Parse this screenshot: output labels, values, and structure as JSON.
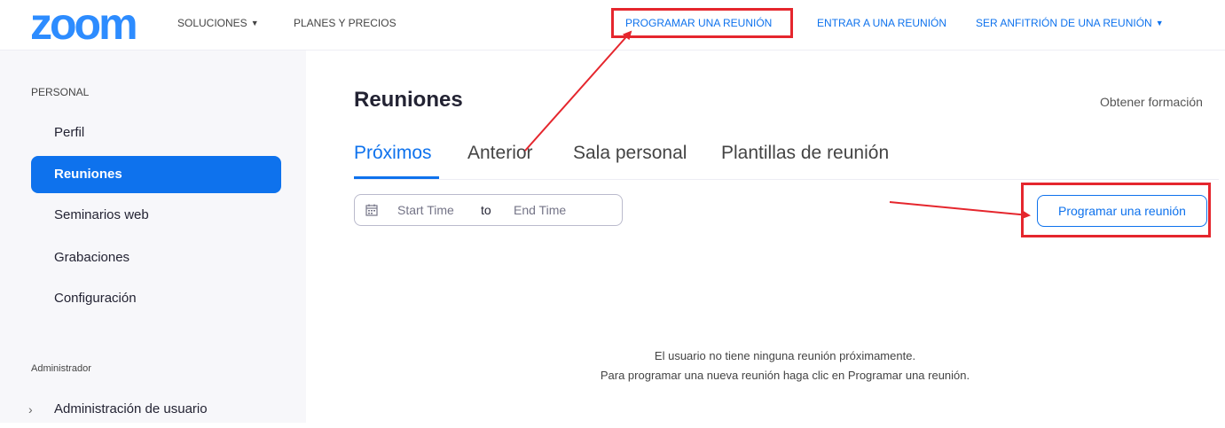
{
  "topnav": {
    "logo": "zoom",
    "solutions": "SOLUCIONES",
    "plans": "PLANES Y PRECIOS",
    "schedule": "PROGRAMAR UNA REUNIÓN",
    "join": "ENTRAR A UNA REUNIÓN",
    "host": "SER ANFITRIÓN DE UNA REUNIÓN"
  },
  "sidebar": {
    "section_personal": "PERSONAL",
    "items": [
      {
        "label": "Perfil"
      },
      {
        "label": "Reuniones",
        "active": true
      },
      {
        "label": "Seminarios web"
      },
      {
        "label": "Grabaciones"
      },
      {
        "label": "Configuración"
      }
    ],
    "section_admin": "Administrador",
    "admin_items": [
      {
        "label": "Administración de usuario"
      }
    ]
  },
  "main": {
    "title": "Reuniones",
    "training_link": "Obtener formación",
    "tabs": [
      {
        "label": "Próximos",
        "active": true
      },
      {
        "label": "Anterior"
      },
      {
        "label": "Sala personal"
      },
      {
        "label": "Plantillas de reunión"
      }
    ],
    "date_range": {
      "start": "Start Time",
      "to": "to",
      "end": "End Time"
    },
    "schedule_button": "Programar una reunión",
    "empty_line1": "El usuario no tiene ninguna reunión próximamente.",
    "empty_line2": "Para programar una nueva reunión haga clic en Programar una reunión."
  },
  "colors": {
    "brand": "#2d8cff",
    "accent": "#0e72ed",
    "annotation": "#e5262d"
  }
}
